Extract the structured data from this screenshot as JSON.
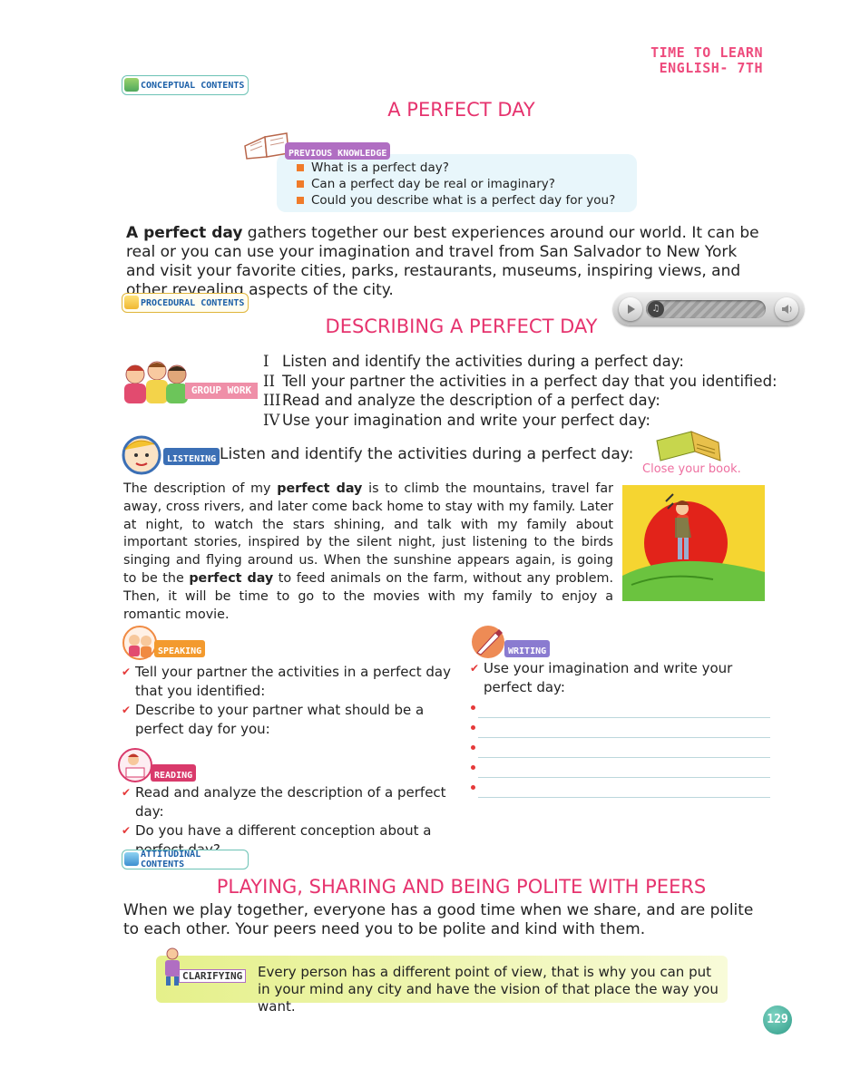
{
  "header": {
    "book_title_line1": "TIME TO LEARN",
    "book_title_line2": "ENGLISH- 7TH"
  },
  "tags": {
    "conceptual": "CONCEPTUAL CONTENTS",
    "procedural": "PROCEDURAL CONTENTS",
    "attitudinal": "ATTITUDINAL CONTENTS"
  },
  "titles": {
    "main": "A PERFECT DAY",
    "describing": "DESCRIBING A PERFECT DAY",
    "playing": "PLAYING, SHARING AND BEING POLITE WITH PEERS"
  },
  "previous_knowledge": {
    "label": "PREVIOUS KNOWLEDGE",
    "items": [
      "What is a perfect day?",
      "Can a perfect day be real or imaginary?",
      "Could you describe what is a perfect day for you?"
    ]
  },
  "intro": {
    "bold": "A perfect day",
    "rest": " gathers together our best experiences around our world. It can be real or you can use your imagination and travel from San Salvador to New York and visit your favorite cities, parks, restaurants, museums, inspiring views, and other revealing aspects of the city."
  },
  "group_work": {
    "label": "GROUP WORK",
    "steps": [
      {
        "num": "I",
        "text": "Listen and identify the activities during a perfect day:"
      },
      {
        "num": "II",
        "text": "Tell your partner the activities in a perfect day that you identified:"
      },
      {
        "num": "III",
        "text": "Read and analyze the description of a perfect day:"
      },
      {
        "num": "IV",
        "text": "Use your imagination and write your perfect day:"
      }
    ]
  },
  "listening": {
    "label": "LISTENING",
    "instruction": "Listen and identify the activities during a perfect day:",
    "close_book": "Close your book.",
    "para_1": "The description of my ",
    "para_bold_1": "perfect day",
    "para_2": " is to climb the mountains, travel far away, cross rivers, and later come back home to stay with my family. Later at night, to watch the stars shining, and talk with my family about important stories, inspired by the silent night, just listening to the birds singing and flying around us. When the sunshine appears again, is going to be the ",
    "para_bold_2": "perfect day",
    "para_3": " to feed animals on the farm, without any problem. Then, it will be time to go to the movies with my family to enjoy a romantic movie."
  },
  "speaking": {
    "label": "SPEAKING",
    "items": [
      "Tell your partner the activities in a perfect day that you identified:",
      "Describe to your partner what should be a perfect day for you:"
    ]
  },
  "reading": {
    "label": "READING",
    "items": [
      "Read and analyze the description of a perfect day:",
      "Do you have a different conception about a perfect day?"
    ]
  },
  "writing": {
    "label": "WRITING",
    "items": [
      "Use your imagination and write your perfect day:"
    ]
  },
  "attitudinal_text": "When we play together, everyone has a good time when we share, and are  polite to each other. Your peers need you to be polite and kind with them.",
  "clarifying": {
    "label": "CLARIFYING",
    "text": "Every person has a different point of view, that is why you can put in your mind any city and have the vision of that place the way you want."
  },
  "page_number": "129",
  "colors": {
    "title_pink": "#e6336e",
    "check_red": "#e53a3a",
    "teal": "#2f9c88"
  }
}
